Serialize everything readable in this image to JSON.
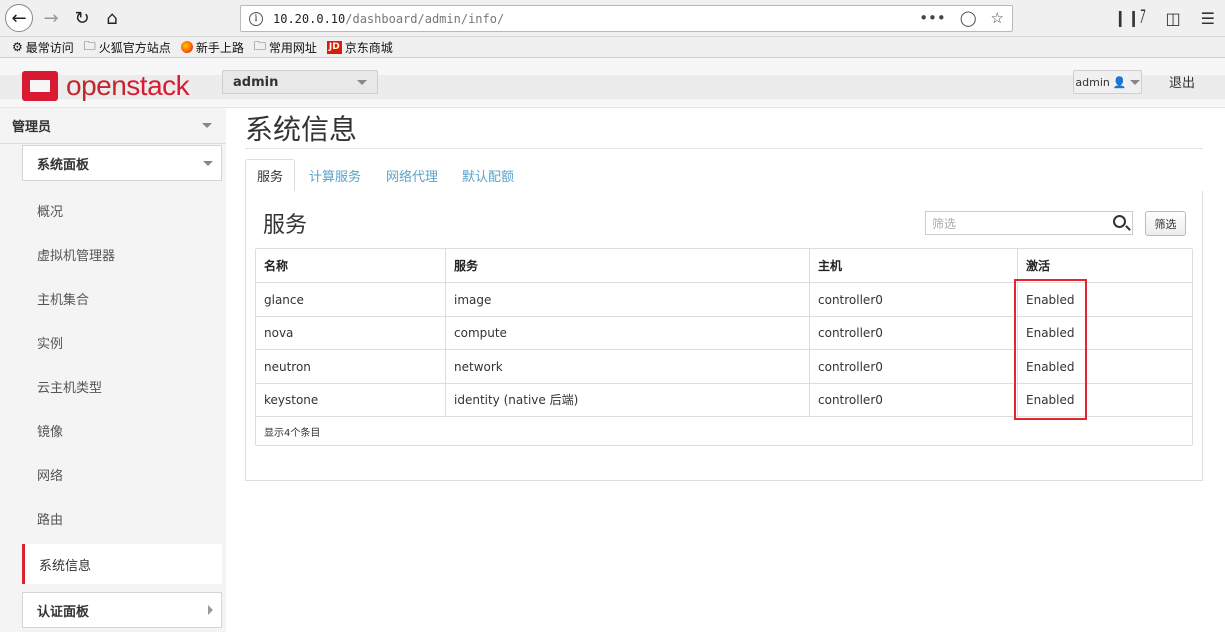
{
  "browser": {
    "url_host": "10.20.0.10",
    "url_path": "/dashboard/admin/info/",
    "url_menu": "•••",
    "bookmarks": [
      {
        "icon": "gear-icon",
        "label": "最常访问"
      },
      {
        "icon": "folder-icon",
        "label": "火狐官方站点"
      },
      {
        "icon": "firefox-icon",
        "label": "新手上路"
      },
      {
        "icon": "folder-icon",
        "label": "常用网址"
      },
      {
        "icon": "jd-icon",
        "label": "京东商城",
        "badge": "JD"
      }
    ]
  },
  "header": {
    "logo_text_a": "open",
    "logo_text_b": "stack",
    "project": "admin",
    "user": "admin",
    "logout": "退出",
    "brand_color": "#da1a32"
  },
  "sidebar": {
    "section": "管理员",
    "panel": "系统面板",
    "items": [
      "概况",
      "虚拟机管理器",
      "主机集合",
      "实例",
      "云主机类型",
      "镜像",
      "网络",
      "路由",
      "系统信息"
    ],
    "active_item": "系统信息",
    "auth_panel": "认证面板"
  },
  "main": {
    "page_title": "系统信息",
    "tabs": [
      "服务",
      "计算服务",
      "网络代理",
      "默认配额"
    ],
    "active_tab": "服务",
    "section_title": "服务",
    "filter_placeholder": "筛选",
    "filter_button": "筛选",
    "table": {
      "headers": [
        "名称",
        "服务",
        "主机",
        "激活"
      ],
      "rows": [
        [
          "glance",
          "image",
          "controller0",
          "Enabled"
        ],
        [
          "nova",
          "compute",
          "controller0",
          "Enabled"
        ],
        [
          "neutron",
          "network",
          "controller0",
          "Enabled"
        ],
        [
          "keystone",
          "identity (native 后端)",
          "controller0",
          "Enabled"
        ]
      ],
      "footer": "显示4个条目"
    }
  }
}
